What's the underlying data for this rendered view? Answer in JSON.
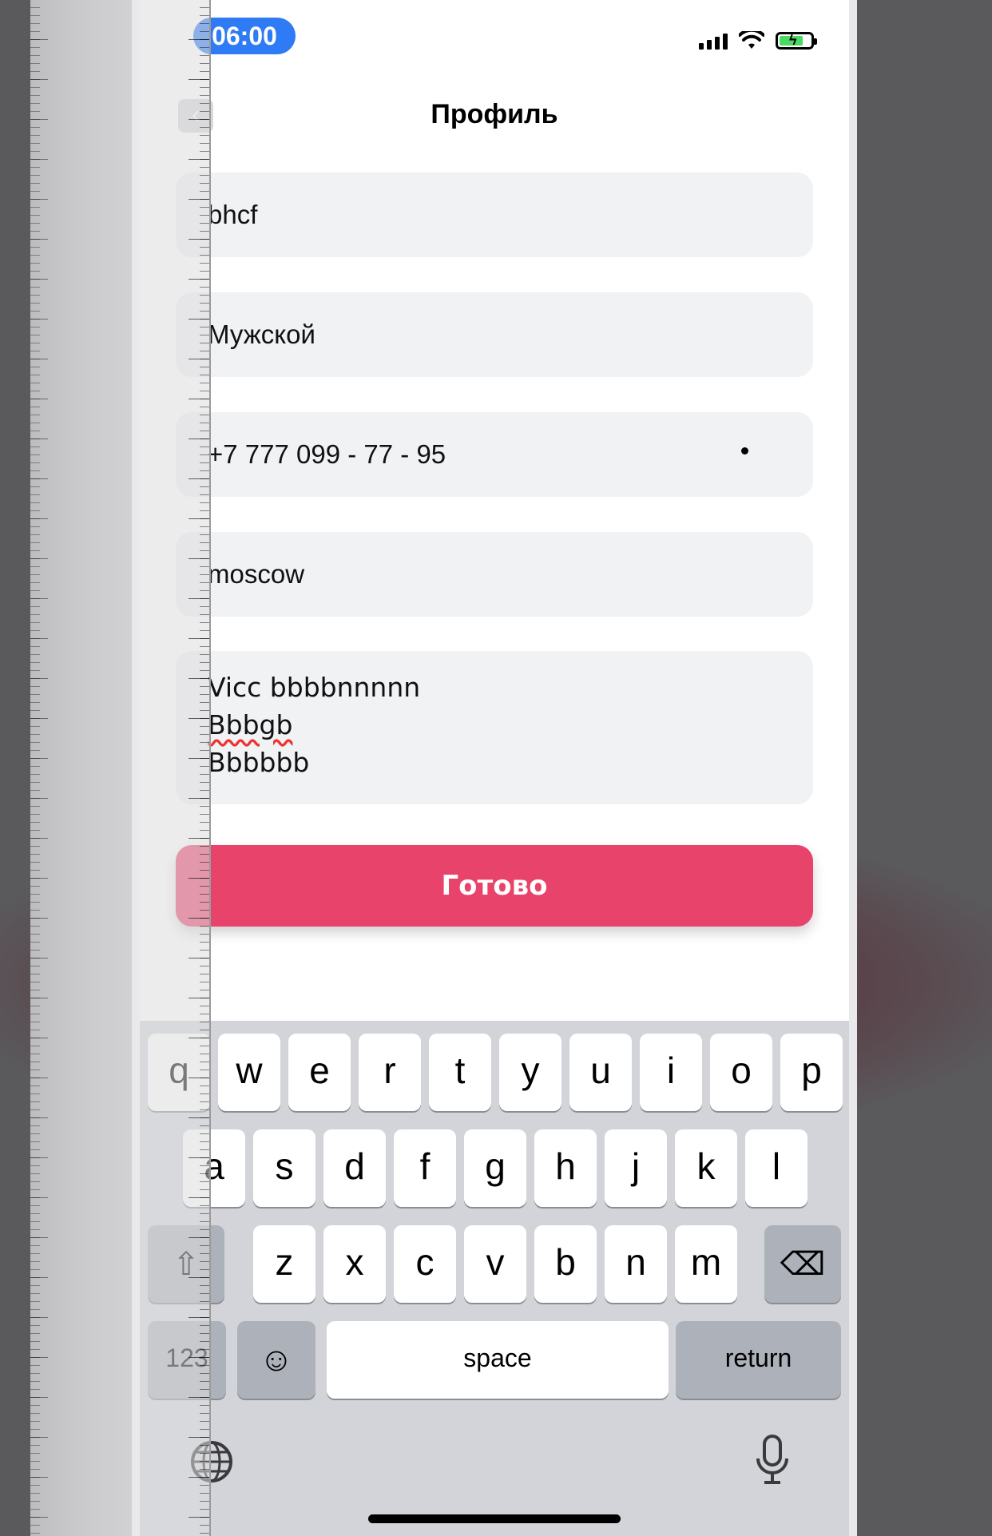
{
  "status_bar": {
    "time": "06:00"
  },
  "nav": {
    "title": "Профиль",
    "back_icon": "chevron-left-icon"
  },
  "form": {
    "name": "bhcf",
    "gender": "Мужской",
    "phone": "+7 777 099 - 77 - 95",
    "city": "moscow",
    "about": [
      "Vicc bbbbnnnnn",
      "Bbbgb",
      "Bbbbbb"
    ],
    "done_label": "Готово"
  },
  "keyboard": {
    "row1": [
      "q",
      "w",
      "e",
      "r",
      "t",
      "y",
      "u",
      "i",
      "o",
      "p"
    ],
    "row2": [
      "a",
      "s",
      "d",
      "f",
      "g",
      "h",
      "j",
      "k",
      "l"
    ],
    "row3": [
      "z",
      "x",
      "c",
      "v",
      "b",
      "n",
      "m"
    ],
    "numbers_label": "123",
    "space_label": "space",
    "return_label": "return",
    "icons": [
      "shift-icon",
      "backspace-icon",
      "emoji-icon",
      "globe-icon",
      "microphone-icon"
    ]
  },
  "colors": {
    "accent": "#e8436a",
    "time_pill": "#2f7bf5",
    "battery": "#4bd964"
  }
}
